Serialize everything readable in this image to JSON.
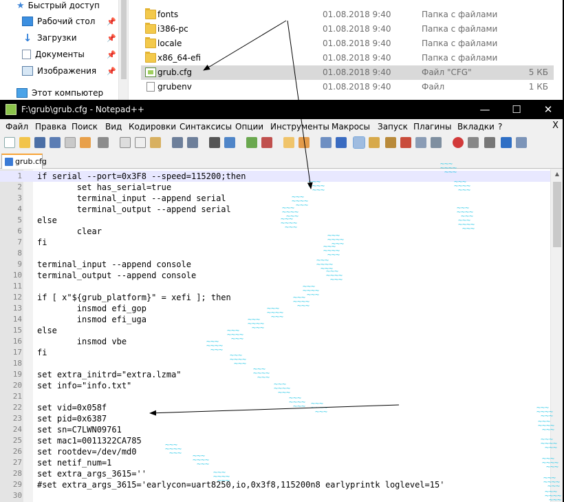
{
  "explorer": {
    "nav": {
      "quick_access": "Быстрый доступ",
      "items": [
        {
          "label": "Рабочий стол",
          "pinned_icon": "📌"
        },
        {
          "label": "Загрузки",
          "pinned_icon": "📌"
        },
        {
          "label": "Документы",
          "pinned_icon": "📌"
        },
        {
          "label": "Изображения",
          "pinned_icon": "📌"
        }
      ],
      "this_pc": "Этот компьютер"
    },
    "files": [
      {
        "name": "fonts",
        "date": "01.08.2018 9:40",
        "type": "Папка с файлами",
        "size": "",
        "icon": "folder-icon"
      },
      {
        "name": "i386-pc",
        "date": "01.08.2018 9:40",
        "type": "Папка с файлами",
        "size": "",
        "icon": "folder-icon"
      },
      {
        "name": "locale",
        "date": "01.08.2018 9:40",
        "type": "Папка с файлами",
        "size": "",
        "icon": "folder-icon"
      },
      {
        "name": "x86_64-efi",
        "date": "01.08.2018 9:40",
        "type": "Папка с файлами",
        "size": "",
        "icon": "folder-icon"
      },
      {
        "name": "grub.cfg",
        "date": "01.08.2018 9:40",
        "type": "Файл \"CFG\"",
        "size": "5 КБ",
        "icon": "notepadpp-file-icon"
      },
      {
        "name": "grubenv",
        "date": "01.08.2018 9:40",
        "type": "Файл",
        "size": "1 КБ",
        "icon": "file-icon"
      }
    ]
  },
  "npp": {
    "title": "F:\\grub\\grub.cfg - Notepad++",
    "window_buttons": {
      "minimize": "—",
      "maximize": "☐",
      "close": "✕"
    },
    "menu": [
      "Файл",
      "Правка",
      "Поиск",
      "Вид",
      "Кодировки",
      "Синтаксисы",
      "Опции",
      "Инструменты",
      "Макросы",
      "Запуск",
      "Плагины",
      "Вкладки",
      "?"
    ],
    "menu_close": "X",
    "tab_label": "grub.cfg",
    "lines": [
      {
        "n": "1",
        "text": "if serial --port=0x3F8 --speed=115200;then"
      },
      {
        "n": "2",
        "text": "        set has_serial=true"
      },
      {
        "n": "3",
        "text": "        terminal_input --append serial"
      },
      {
        "n": "4",
        "text": "        terminal_output --append serial"
      },
      {
        "n": "5",
        "text": "else"
      },
      {
        "n": "6",
        "text": "        clear"
      },
      {
        "n": "7",
        "text": "fi"
      },
      {
        "n": "8",
        "text": ""
      },
      {
        "n": "9",
        "text": "terminal_input --append console"
      },
      {
        "n": "10",
        "text": "terminal_output --append console"
      },
      {
        "n": "11",
        "text": ""
      },
      {
        "n": "12",
        "text": "if [ x\"${grub_platform}\" = xefi ]; then"
      },
      {
        "n": "13",
        "text": "        insmod efi_gop"
      },
      {
        "n": "14",
        "text": "        insmod efi_uga"
      },
      {
        "n": "15",
        "text": "else"
      },
      {
        "n": "16",
        "text": "        insmod vbe"
      },
      {
        "n": "17",
        "text": "fi"
      },
      {
        "n": "18",
        "text": ""
      },
      {
        "n": "19",
        "text": "set extra_initrd=\"extra.lzma\""
      },
      {
        "n": "20",
        "text": "set info=\"info.txt\""
      },
      {
        "n": "21",
        "text": ""
      },
      {
        "n": "22",
        "text": "set vid=0x058f"
      },
      {
        "n": "23",
        "text": "set pid=0x6387"
      },
      {
        "n": "24",
        "text": "set sn=C7LWN09761"
      },
      {
        "n": "25",
        "text": "set mac1=0011322CA785"
      },
      {
        "n": "26",
        "text": "set rootdev=/dev/md0"
      },
      {
        "n": "27",
        "text": "set netif_num=1"
      },
      {
        "n": "28",
        "text": "set extra_args_3615=''"
      },
      {
        "n": "29",
        "text": "#set extra_args_3615='earlycon=uart8250,io,0x3f8,115200n8 earlyprintk loglevel=15'"
      },
      {
        "n": "30",
        "text": ""
      }
    ]
  }
}
